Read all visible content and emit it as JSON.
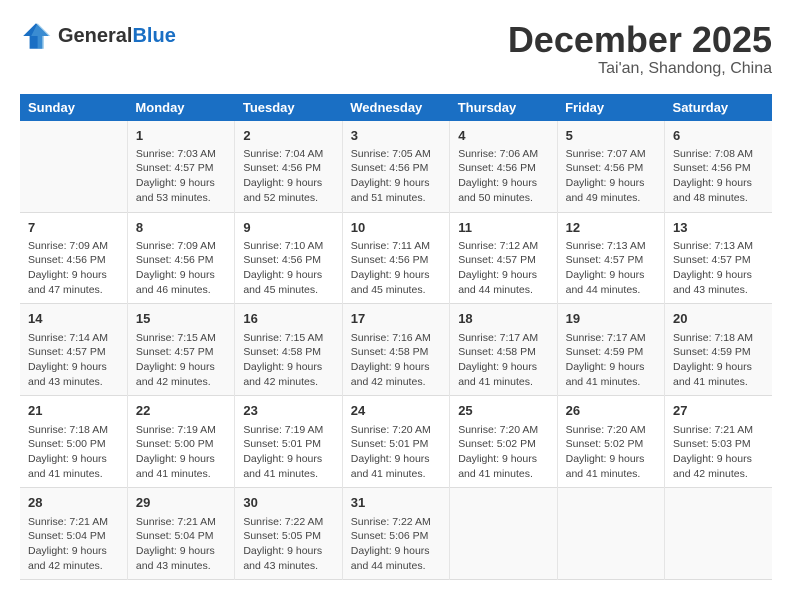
{
  "header": {
    "logo_line1": "General",
    "logo_line2": "Blue",
    "title": "December 2025",
    "subtitle": "Tai'an, Shandong, China"
  },
  "days_of_week": [
    "Sunday",
    "Monday",
    "Tuesday",
    "Wednesday",
    "Thursday",
    "Friday",
    "Saturday"
  ],
  "weeks": [
    [
      {
        "day": "",
        "info": ""
      },
      {
        "day": "1",
        "info": "Sunrise: 7:03 AM\nSunset: 4:57 PM\nDaylight: 9 hours\nand 53 minutes."
      },
      {
        "day": "2",
        "info": "Sunrise: 7:04 AM\nSunset: 4:56 PM\nDaylight: 9 hours\nand 52 minutes."
      },
      {
        "day": "3",
        "info": "Sunrise: 7:05 AM\nSunset: 4:56 PM\nDaylight: 9 hours\nand 51 minutes."
      },
      {
        "day": "4",
        "info": "Sunrise: 7:06 AM\nSunset: 4:56 PM\nDaylight: 9 hours\nand 50 minutes."
      },
      {
        "day": "5",
        "info": "Sunrise: 7:07 AM\nSunset: 4:56 PM\nDaylight: 9 hours\nand 49 minutes."
      },
      {
        "day": "6",
        "info": "Sunrise: 7:08 AM\nSunset: 4:56 PM\nDaylight: 9 hours\nand 48 minutes."
      }
    ],
    [
      {
        "day": "7",
        "info": "Sunrise: 7:09 AM\nSunset: 4:56 PM\nDaylight: 9 hours\nand 47 minutes."
      },
      {
        "day": "8",
        "info": "Sunrise: 7:09 AM\nSunset: 4:56 PM\nDaylight: 9 hours\nand 46 minutes."
      },
      {
        "day": "9",
        "info": "Sunrise: 7:10 AM\nSunset: 4:56 PM\nDaylight: 9 hours\nand 45 minutes."
      },
      {
        "day": "10",
        "info": "Sunrise: 7:11 AM\nSunset: 4:56 PM\nDaylight: 9 hours\nand 45 minutes."
      },
      {
        "day": "11",
        "info": "Sunrise: 7:12 AM\nSunset: 4:57 PM\nDaylight: 9 hours\nand 44 minutes."
      },
      {
        "day": "12",
        "info": "Sunrise: 7:13 AM\nSunset: 4:57 PM\nDaylight: 9 hours\nand 44 minutes."
      },
      {
        "day": "13",
        "info": "Sunrise: 7:13 AM\nSunset: 4:57 PM\nDaylight: 9 hours\nand 43 minutes."
      }
    ],
    [
      {
        "day": "14",
        "info": "Sunrise: 7:14 AM\nSunset: 4:57 PM\nDaylight: 9 hours\nand 43 minutes."
      },
      {
        "day": "15",
        "info": "Sunrise: 7:15 AM\nSunset: 4:57 PM\nDaylight: 9 hours\nand 42 minutes."
      },
      {
        "day": "16",
        "info": "Sunrise: 7:15 AM\nSunset: 4:58 PM\nDaylight: 9 hours\nand 42 minutes."
      },
      {
        "day": "17",
        "info": "Sunrise: 7:16 AM\nSunset: 4:58 PM\nDaylight: 9 hours\nand 42 minutes."
      },
      {
        "day": "18",
        "info": "Sunrise: 7:17 AM\nSunset: 4:58 PM\nDaylight: 9 hours\nand 41 minutes."
      },
      {
        "day": "19",
        "info": "Sunrise: 7:17 AM\nSunset: 4:59 PM\nDaylight: 9 hours\nand 41 minutes."
      },
      {
        "day": "20",
        "info": "Sunrise: 7:18 AM\nSunset: 4:59 PM\nDaylight: 9 hours\nand 41 minutes."
      }
    ],
    [
      {
        "day": "21",
        "info": "Sunrise: 7:18 AM\nSunset: 5:00 PM\nDaylight: 9 hours\nand 41 minutes."
      },
      {
        "day": "22",
        "info": "Sunrise: 7:19 AM\nSunset: 5:00 PM\nDaylight: 9 hours\nand 41 minutes."
      },
      {
        "day": "23",
        "info": "Sunrise: 7:19 AM\nSunset: 5:01 PM\nDaylight: 9 hours\nand 41 minutes."
      },
      {
        "day": "24",
        "info": "Sunrise: 7:20 AM\nSunset: 5:01 PM\nDaylight: 9 hours\nand 41 minutes."
      },
      {
        "day": "25",
        "info": "Sunrise: 7:20 AM\nSunset: 5:02 PM\nDaylight: 9 hours\nand 41 minutes."
      },
      {
        "day": "26",
        "info": "Sunrise: 7:20 AM\nSunset: 5:02 PM\nDaylight: 9 hours\nand 41 minutes."
      },
      {
        "day": "27",
        "info": "Sunrise: 7:21 AM\nSunset: 5:03 PM\nDaylight: 9 hours\nand 42 minutes."
      }
    ],
    [
      {
        "day": "28",
        "info": "Sunrise: 7:21 AM\nSunset: 5:04 PM\nDaylight: 9 hours\nand 42 minutes."
      },
      {
        "day": "29",
        "info": "Sunrise: 7:21 AM\nSunset: 5:04 PM\nDaylight: 9 hours\nand 43 minutes."
      },
      {
        "day": "30",
        "info": "Sunrise: 7:22 AM\nSunset: 5:05 PM\nDaylight: 9 hours\nand 43 minutes."
      },
      {
        "day": "31",
        "info": "Sunrise: 7:22 AM\nSunset: 5:06 PM\nDaylight: 9 hours\nand 44 minutes."
      },
      {
        "day": "",
        "info": ""
      },
      {
        "day": "",
        "info": ""
      },
      {
        "day": "",
        "info": ""
      }
    ]
  ]
}
